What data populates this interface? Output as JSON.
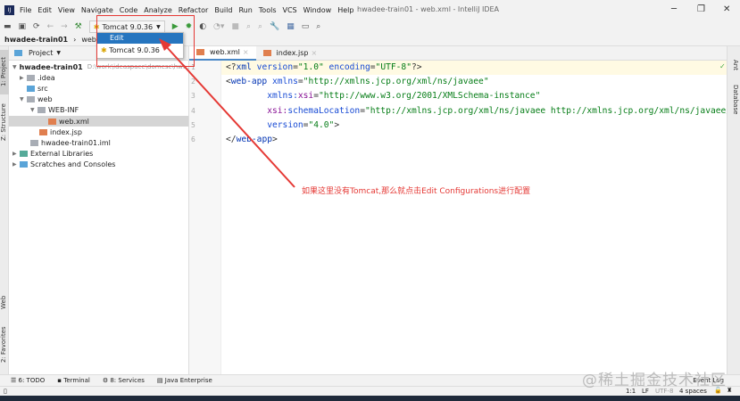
{
  "window": {
    "title": "hwadee-train01 - web.xml - IntelliJ IDEA"
  },
  "menu": [
    "File",
    "Edit",
    "View",
    "Navigate",
    "Code",
    "Analyze",
    "Refactor",
    "Build",
    "Run",
    "Tools",
    "VCS",
    "Window",
    "Help"
  ],
  "toolbar": {
    "run_config": "Tomcat 9.0.36"
  },
  "breadcrumb": [
    "hwadee-train01",
    "web",
    "WE"
  ],
  "popup": {
    "items": [
      "Edit Configurations...",
      "Tomcat 9.0.36"
    ]
  },
  "left_strip": {
    "tabs": [
      "1: Project",
      "Z: Structure",
      "Web",
      "2: Favorites"
    ]
  },
  "project": {
    "header": "Project",
    "root": "hwadee-train01",
    "root_path": "D:\\work\\ideaspace\\domesc\\hwt...",
    "items": [
      ".idea",
      "src",
      "web",
      "WEB-INF",
      "web.xml",
      "index.jsp",
      "hwadee-train01.iml",
      "External Libraries",
      "Scratches and Consoles"
    ]
  },
  "tabs": [
    "web.xml",
    "index.jsp"
  ],
  "code": {
    "lines": [
      "1",
      "2",
      "3",
      "4",
      "5",
      "6"
    ]
  },
  "right_strip": {
    "tabs": [
      "Ant",
      "Database"
    ]
  },
  "bottom_tools": [
    "6: TODO",
    "Terminal",
    "8: Services",
    "Java Enterprise",
    "Event Log"
  ],
  "status": {
    "position": "1:1",
    "line_sep": "LF",
    "encoding": "UTF-8",
    "indent": "4 spaces"
  },
  "annotation": "如果这里没有Tomcat,那么就点击Edit Configurations进行配置",
  "watermark": "@稀土掘金技术社区",
  "colors": {
    "annotation": "#e53935",
    "selection": "#2675bf"
  }
}
